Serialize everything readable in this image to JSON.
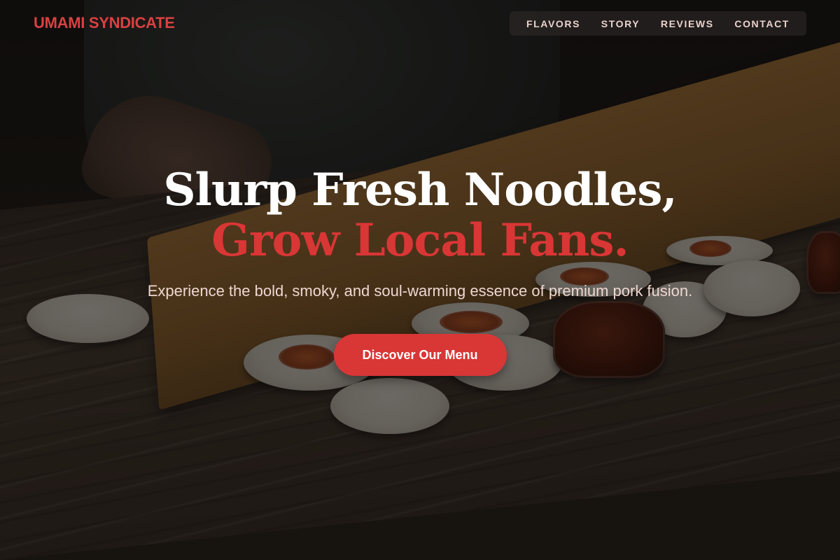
{
  "header": {
    "brand": "UMAMI SYNDICATE",
    "nav": {
      "flavors": "FLAVORS",
      "story": "STORY",
      "reviews": "REVIEWS",
      "contact": "CONTACT"
    }
  },
  "hero": {
    "headline_line1": "Slurp Fresh Noodles,",
    "headline_line2": "Grow Local Fans.",
    "subtitle": "Experience the bold, smoky, and soul-warming essence of premium pork fusion.",
    "cta_label": "Discover Our Menu",
    "background_image": "chef plating small bowls of ramen dishes on a wooden tray over a dark wood counter"
  },
  "colors": {
    "accent": "#d93636",
    "brand_text": "#d94141",
    "nav_text": "#e9d3cd",
    "headline_text": "#ffffff",
    "subtitle_text": "#eed7d1"
  }
}
